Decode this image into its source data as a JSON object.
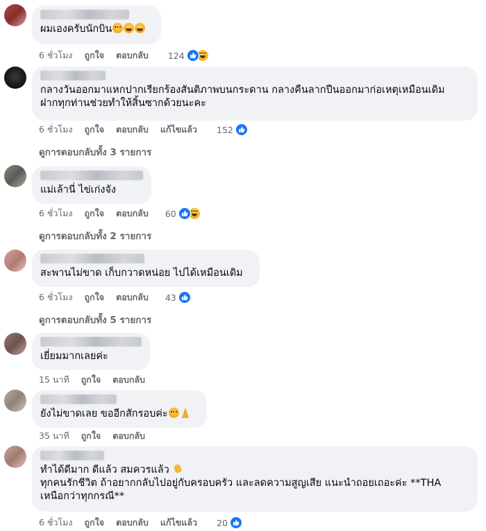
{
  "comments": [
    {
      "text_lines": [
        "ผมเองครับนักบิน"
      ],
      "inline_emojis": [
        "flushed-face",
        "grinning-face",
        "grinning-face"
      ],
      "time": "6 ชั่วโมง",
      "like_label": "ถูกใจ",
      "reply_label": "ตอบกลับ",
      "edited_label": "",
      "reaction_count": "124",
      "reactions": [
        "like",
        "haha"
      ]
    },
    {
      "text_lines": [
        "กลางวันออกมาแหกปากเรียกร้องสันติภาพบนกระดาน กลางคืนลากปืนออกมาก่อเหตุเหมือนเดิม",
        "ฝากทุกท่านช่วยทำให้สิ้นซากด้วยนะคะ"
      ],
      "inline_emojis": [],
      "time": "6 ชั่วโมง",
      "like_label": "ถูกใจ",
      "reply_label": "ตอบกลับ",
      "edited_label": "แก้ไขแล้ว",
      "reaction_count": "152",
      "reactions": [
        "like"
      ],
      "view_replies": "ดูการตอบกลับทั้ง 3 รายการ"
    },
    {
      "text_lines": [
        "แม่เล้านี่ ไข่เก่งจัง"
      ],
      "inline_emojis": [],
      "time": "6 ชั่วโมง",
      "like_label": "ถูกใจ",
      "reply_label": "ตอบกลับ",
      "edited_label": "",
      "reaction_count": "60",
      "reactions": [
        "like",
        "haha"
      ],
      "view_replies": "ดูการตอบกลับทั้ง 2 รายการ"
    },
    {
      "text_lines": [
        "สะพานไม่ขาด เก็บกวาดหน่อย ไปได้เหมือนเดิม"
      ],
      "inline_emojis": [],
      "time": "6 ชั่วโมง",
      "like_label": "ถูกใจ",
      "reply_label": "ตอบกลับ",
      "edited_label": "",
      "reaction_count": "43",
      "reactions": [
        "like"
      ],
      "view_replies": "ดูการตอบกลับทั้ง 5 รายการ"
    },
    {
      "text_lines": [
        "เยี่ยมมากเลยค่ะ"
      ],
      "inline_emojis": [],
      "time": "15 นาที",
      "like_label": "ถูกใจ",
      "reply_label": "ตอบกลับ",
      "edited_label": "",
      "reaction_count": "",
      "reactions": []
    },
    {
      "text_lines": [
        "ยังไม่ขาดเลย ขออีกสักรอบค่ะ"
      ],
      "inline_emojis": [
        "flushed-face",
        "folded-hands"
      ],
      "time": "35 นาที",
      "like_label": "ถูกใจ",
      "reply_label": "ตอบกลับ",
      "edited_label": "",
      "reaction_count": "",
      "reactions": []
    },
    {
      "text_lines": [
        "ทำได้ดีมาก ดีแล้ว สมควรแล้ว",
        "ทุกคนรักชีวิต ถ้าอยากกลับไปอยู่กับครอบครัว และลดความสูญเสีย แนะนำถอยเถอะค่ะ **THA",
        "เหนือกว่าทุกกรณี**"
      ],
      "inline_emojis": [
        "clapping-hands"
      ],
      "time": "6 ชั่วโมง",
      "like_label": "ถูกใจ",
      "reply_label": "ตอบกลับ",
      "edited_label": "แก้ไขแล้ว",
      "reaction_count": "20",
      "reactions": [
        "like"
      ]
    }
  ],
  "colors": {
    "bubble": "#f0f2f5",
    "meta_text": "#65676b",
    "like_blue": "#1877f2",
    "haha_yellow": "#f7b125"
  }
}
